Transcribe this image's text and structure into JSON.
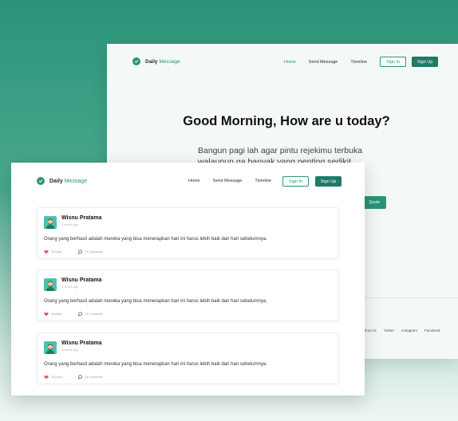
{
  "back_page": {
    "logo": {
      "brand": "Daily",
      "accent": "Message"
    },
    "nav": {
      "links": [
        "Home",
        "Send Message",
        "Timeline"
      ],
      "active_index": 0,
      "sign_in": "Sign In",
      "sign_up": "Sign Up"
    },
    "hero": {
      "title": "Good Morning, How are u today?",
      "subtitle": "Bangun pagi lah agar pintu rejekimu terbuka walaupun ga banyak yang penting sedikit",
      "cta": "Quote"
    },
    "footer_links": [
      "Follow Us",
      "Twitter",
      "Instagram",
      "Facebook"
    ]
  },
  "front_page": {
    "logo": {
      "brand": "Daily",
      "accent": "Message"
    },
    "nav": {
      "links": [
        "Home",
        "Send Message",
        "Timeline"
      ],
      "sign_in": "Sign In",
      "sign_up": "Sign Up"
    },
    "posts": [
      {
        "author": "Wisnu Pratama",
        "time": "3 hours ago",
        "content": "Orang yang berhasil adalah mereka yang bisa menerapkan hari ini harus lebih baik dari hari sebelumnya.",
        "likes": "234 likes",
        "comments": "15 Comments"
      },
      {
        "author": "Wisnu Pratama",
        "time": "3 hours ago",
        "content": "Orang yang berhasil adalah mereka yang bisa menerapkan hari ini harus lebih baik dari hari sebelumnya.",
        "likes": "234 likes",
        "comments": "15 Comments"
      },
      {
        "author": "Wisnu Pratama",
        "time": "3 hours ago",
        "content": "Orang yang berhasil adalah mereka yang bisa menerapkan hari ini harus lebih baik dari hari sebelumnya.",
        "likes": "234 likes",
        "comments": "15 Comments"
      }
    ]
  },
  "icons": {
    "logo": "check-circle-icon",
    "like": "heart-icon",
    "comment": "comment-bubble-icon",
    "avatar": "user-avatar-icon"
  },
  "colors": {
    "primary": "#2a9479",
    "primary_dark": "#1d7b66",
    "like": "#e8544e"
  }
}
